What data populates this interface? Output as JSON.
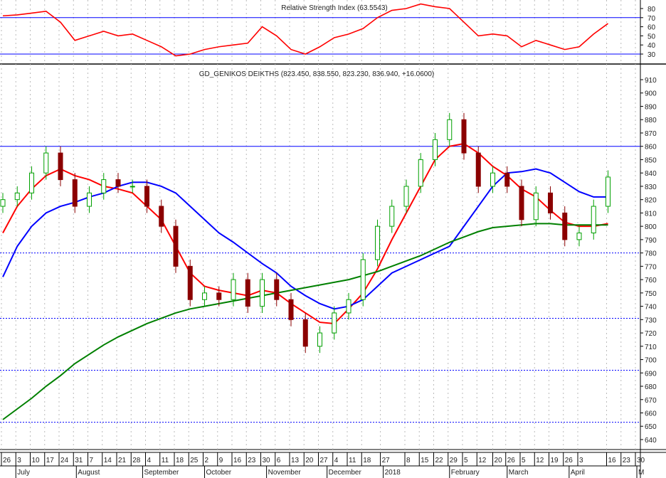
{
  "chart_data": [
    {
      "type": "line",
      "title": "Relative Strength Index (63.5543)",
      "ylim": [
        15,
        85
      ],
      "yticks": [
        30,
        40,
        50,
        60,
        70,
        80
      ],
      "levels": [
        70,
        30
      ],
      "color": "#ff0000",
      "values": [
        72,
        73,
        75,
        77,
        65,
        45,
        50,
        55,
        50,
        52,
        45,
        38,
        28,
        30,
        35,
        38,
        40,
        42,
        60,
        50,
        35,
        30,
        38,
        48,
        52,
        58,
        70,
        78,
        80,
        85,
        82,
        80,
        65,
        50,
        52,
        50,
        38,
        45,
        40,
        35,
        38,
        52,
        63.55
      ]
    },
    {
      "type": "candlestick",
      "title": "GD_GENIKOS DEIKTHS (823.450, 838.550, 823.230, 836.940, +16.0600)",
      "ylim": [
        632,
        918
      ],
      "yticks": [
        640,
        650,
        660,
        670,
        680,
        690,
        700,
        710,
        720,
        730,
        740,
        750,
        760,
        770,
        780,
        790,
        800,
        810,
        820,
        830,
        840,
        850,
        860,
        870,
        880,
        890,
        900,
        910
      ],
      "levels": [
        {
          "value": 860,
          "style": "solid"
        },
        {
          "value": 780,
          "style": "dotted"
        },
        {
          "value": 731,
          "style": "dotted"
        },
        {
          "value": 692,
          "style": "dotted"
        },
        {
          "value": 653,
          "style": "dotted"
        }
      ],
      "close": [
        820,
        825,
        840,
        855,
        835,
        815,
        825,
        835,
        830,
        830,
        815,
        800,
        770,
        745,
        750,
        745,
        760,
        740,
        760,
        745,
        730,
        710,
        720,
        735,
        745,
        775,
        800,
        815,
        830,
        850,
        865,
        880,
        855,
        830,
        840,
        830,
        805,
        825,
        810,
        790,
        795,
        815,
        836.94
      ],
      "series": [
        {
          "name": "MA short",
          "color": "#ff0000",
          "values": [
            795,
            815,
            828,
            838,
            843,
            838,
            835,
            830,
            828,
            825,
            815,
            805,
            785,
            765,
            755,
            752,
            750,
            748,
            752,
            750,
            742,
            735,
            728,
            727,
            738,
            750,
            768,
            790,
            810,
            830,
            850,
            860,
            862,
            855,
            845,
            838,
            828,
            822,
            812,
            803,
            800,
            800,
            802
          ]
        },
        {
          "name": "MA medium",
          "color": "#0000ff",
          "values": [
            762,
            785,
            800,
            810,
            815,
            818,
            822,
            825,
            830,
            833,
            833,
            830,
            825,
            815,
            805,
            795,
            788,
            780,
            772,
            765,
            755,
            748,
            742,
            738,
            740,
            745,
            755,
            765,
            770,
            775,
            780,
            785,
            800,
            815,
            830,
            840,
            841,
            843,
            840,
            833,
            826,
            822,
            822
          ]
        },
        {
          "name": "MA long",
          "color": "#008000",
          "values": [
            655,
            663,
            671,
            680,
            688,
            697,
            704,
            711,
            717,
            722,
            727,
            731,
            735,
            738,
            740,
            742,
            744,
            746,
            748,
            750,
            752,
            754,
            756,
            758,
            760,
            763,
            766,
            770,
            774,
            778,
            783,
            788,
            792,
            796,
            799,
            800,
            801,
            802,
            802,
            801,
            801,
            801,
            801
          ]
        }
      ]
    },
    {
      "type": "axis",
      "x_ticks": [
        "26",
        "3",
        "10",
        "17",
        "24",
        "31",
        "7",
        "14",
        "21",
        "28",
        "4",
        "11",
        "18",
        "25",
        "2",
        "9",
        "16",
        "23",
        "30",
        "6",
        "13",
        "20",
        "27",
        "4",
        "11",
        "18",
        "27",
        "8",
        "15",
        "22",
        "29",
        "5",
        "12",
        "20",
        "26",
        "5",
        "12",
        "19",
        "26",
        "3",
        "16",
        "23",
        "30"
      ],
      "x_tick_weeks": [
        0,
        1,
        2,
        3,
        4,
        5,
        6,
        7,
        8,
        9,
        10,
        11,
        12,
        13,
        14,
        15,
        16,
        17,
        18,
        19,
        20,
        21,
        22,
        23,
        24,
        25,
        26.3,
        28,
        29,
        30,
        31,
        32,
        33,
        34.1,
        35,
        36,
        37,
        38,
        39,
        40,
        42,
        43,
        44
      ],
      "months": [
        {
          "label": "July",
          "week": 1
        },
        {
          "label": "August",
          "week": 5.2
        },
        {
          "label": "September",
          "week": 9.8
        },
        {
          "label": "October",
          "week": 14.1
        },
        {
          "label": "November",
          "week": 18.4
        },
        {
          "label": "December",
          "week": 22.6
        },
        {
          "label": "2018",
          "week": 26.5
        },
        {
          "label": "February",
          "week": 31.1
        },
        {
          "label": "March",
          "week": 35.1
        },
        {
          "label": "April",
          "week": 39.4
        },
        {
          "label": "M",
          "week": 44.1
        }
      ]
    }
  ]
}
